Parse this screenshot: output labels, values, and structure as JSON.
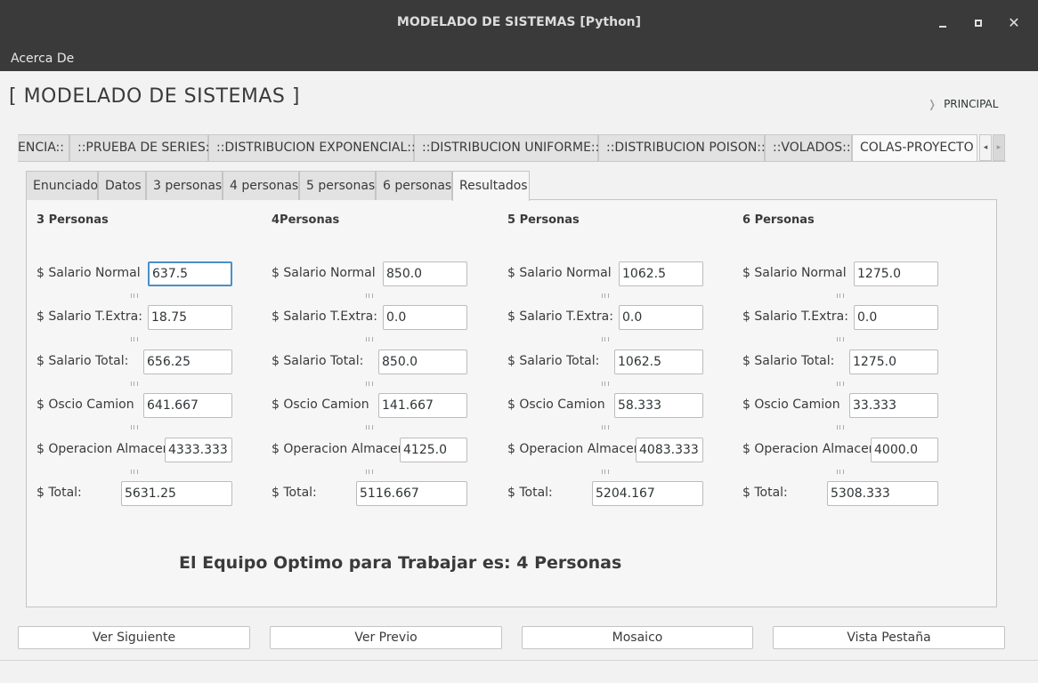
{
  "window": {
    "title": "MODELADO DE SISTEMAS [Python]",
    "close_glyph": "✕"
  },
  "menu": {
    "acerca_de": "Acerca De"
  },
  "app": {
    "title": "[ MODELADO DE SISTEMAS ]",
    "principal": "PRINCIPAL",
    "principal_chevron": "❭"
  },
  "outer_tabs": [
    {
      "label": "ENCIA::"
    },
    {
      "label": "::PRUEBA DE SERIES::"
    },
    {
      "label": "::DISTRIBUCION EXPONENCIAL::"
    },
    {
      "label": "::DISTRIBUCION UNIFORME::"
    },
    {
      "label": "::DISTRIBUCION POISON::"
    },
    {
      "label": "::VOLADOS::"
    },
    {
      "label": "COLAS-PROYECTO",
      "active": true
    }
  ],
  "tab_scroll": {
    "left": "◂",
    "right": "▸"
  },
  "inner_tabs": [
    {
      "label": "Enunciado"
    },
    {
      "label": "Datos"
    },
    {
      "label": "3 personas"
    },
    {
      "label": "4 personas"
    },
    {
      "label": "5 personas"
    },
    {
      "label": "6 personas"
    },
    {
      "label": "Resultados",
      "active": true
    }
  ],
  "labels": {
    "salario_normal": "$ Salario Normal",
    "salario_extra": "$ Salario T.Extra:",
    "salario_total": "$ Salario Total:",
    "oscio_camion": "$ Oscio Camion",
    "operacion_almacen": "$ Operacion Almacen",
    "total": "$ Total:"
  },
  "columns": [
    {
      "heading": "3 Personas",
      "salario_normal": "637.5",
      "salario_extra": "18.75",
      "salario_total": "656.25",
      "oscio_camion": "641.667",
      "operacion_almacen": "4333.333",
      "total": "5631.25"
    },
    {
      "heading": "4Personas",
      "salario_normal": "850.0",
      "salario_extra": "0.0",
      "salario_total": "850.0",
      "oscio_camion": "141.667",
      "operacion_almacen": "4125.0",
      "total": "5116.667"
    },
    {
      "heading": "5 Personas",
      "salario_normal": "1062.5",
      "salario_extra": "0.0",
      "salario_total": "1062.5",
      "oscio_camion": "58.333",
      "operacion_almacen": "4083.333",
      "total": "5204.167"
    },
    {
      "heading": "6 Personas",
      "salario_normal": "1275.0",
      "salario_extra": "0.0",
      "salario_total": "1275.0",
      "oscio_camion": "33.333",
      "operacion_almacen": "4000.0",
      "total": "5308.333"
    }
  ],
  "result": {
    "text": "El Equipo Optimo para Trabajar es: 4 Personas"
  },
  "buttons": {
    "ver_siguiente": "Ver Siguiente",
    "ver_previo": "Ver Previo",
    "mosaico": "Mosaico",
    "vista_pestana": "Vista Pestaña"
  }
}
